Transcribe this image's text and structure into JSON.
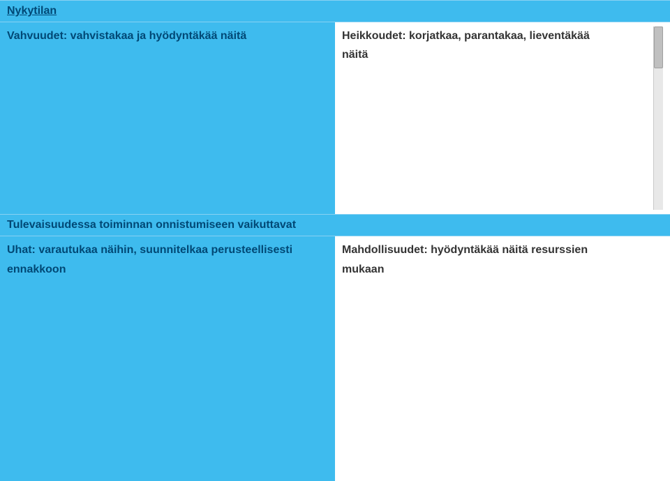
{
  "swot": {
    "current": {
      "title": "Nykytilan",
      "strengths": "Vahvuudet: vahvistakaa ja hyödyntäkää näitä",
      "weaknesses_line1": "Heikkoudet: korjatkaa, parantakaa, lieventäkää",
      "weaknesses_line2": "näitä"
    },
    "future": {
      "title": "Tulevaisuudessa toiminnan onnistumiseen vaikuttavat",
      "threats_line1": "Uhat: varautukaa näihin, suunnitelkaa perusteellisesti",
      "threats_line2": "ennakkoon",
      "opportunities_line1": "Mahdollisuudet: hyödyntäkää näitä resurssien",
      "opportunities_line2": "mukaan"
    }
  }
}
